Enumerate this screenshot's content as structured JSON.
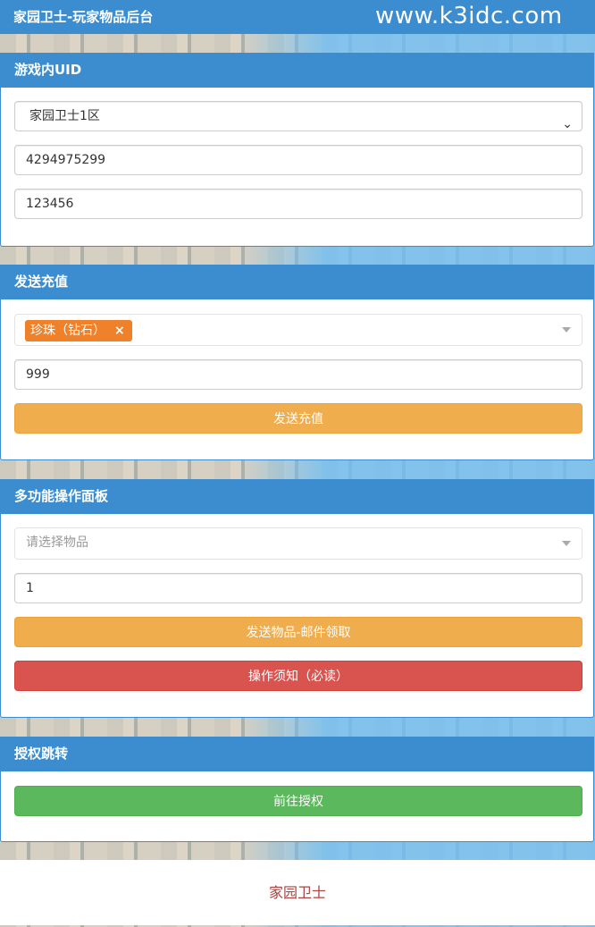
{
  "header": {
    "title": "家园卫士-玩家物品后台",
    "site": "www.k3idc.com"
  },
  "panel_uid": {
    "title": "游戏内UID",
    "server_selected": "家园卫士1区",
    "uid_value": "4294975299",
    "password_value": "123456"
  },
  "panel_recharge": {
    "title": "发送充值",
    "selected_item": "珍珠（钻石）",
    "tag_remove": "×",
    "amount_value": "999",
    "submit_label": "发送充值"
  },
  "panel_multi": {
    "title": "多功能操作面板",
    "item_placeholder": "请选择物品",
    "quantity_value": "1",
    "send_label": "发送物品-邮件领取",
    "notice_label": "操作须知（必读）"
  },
  "panel_auth": {
    "title": "授权跳转",
    "go_label": "前往授权"
  },
  "footer": {
    "text": "家园卫士"
  },
  "colors": {
    "primary": "#3c8dd0",
    "warning": "#f0ad4e",
    "danger": "#d9534f",
    "success": "#5cb85c",
    "tag": "#f0812b",
    "footer_text": "#a94442"
  },
  "icons": {
    "select_arrow": "chevron-down-icon",
    "dropdown_arrow": "caret-down-icon"
  }
}
